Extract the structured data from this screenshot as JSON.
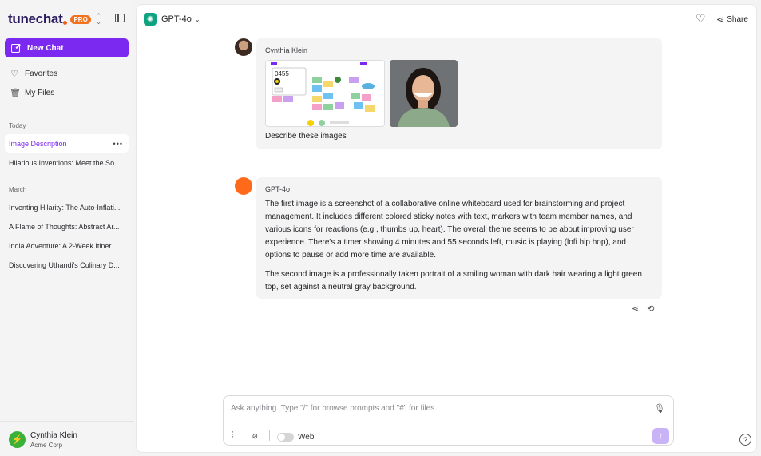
{
  "brand": {
    "name": "tunechat",
    "badge": "PRO"
  },
  "sidebar": {
    "new_chat_label": "New Chat",
    "nav": [
      {
        "label": "Favorites",
        "icon": "heart-icon"
      },
      {
        "label": "My Files",
        "icon": "files-icon"
      }
    ],
    "today_label": "Today",
    "today_items": [
      {
        "title": "Image Description",
        "active": true
      },
      {
        "title": "Hilarious Inventions: Meet the So..."
      }
    ],
    "march_label": "March",
    "march_items": [
      {
        "title": "Inventing Hilarity: The Auto-Inflati..."
      },
      {
        "title": "A Flame of Thoughts: Abstract Ar..."
      },
      {
        "title": "India Adventure: A 2-Week Itiner..."
      },
      {
        "title": "Discovering Uthandi's Culinary D..."
      }
    ]
  },
  "user": {
    "name": "Cynthia Klein",
    "org": "Acme Corp"
  },
  "header": {
    "model": "GPT-4o",
    "share_label": "Share"
  },
  "messages": [
    {
      "sender": "Cynthia Klein",
      "text": "Describe these images"
    },
    {
      "sender": "GPT-4o",
      "paragraphs": [
        "The first image is a screenshot of a collaborative online whiteboard used for brainstorming and project management. It includes different colored sticky notes with text, markers with team member names, and various icons for reactions (e.g., thumbs up, heart). The overall theme seems to be about improving user experience. There's a timer showing 4 minutes and 55 seconds left, music is playing (lofi hip hop), and options to pause or add more time are available.",
        "The second image is a professionally taken portrait of a smiling woman with dark hair wearing a light green top, set against a neutral gray background."
      ]
    }
  ],
  "attachment_timer": "0455",
  "composer": {
    "placeholder": "Ask anything. Type \"/\" for browse prompts and \"#\" for files.",
    "web_label": "Web"
  },
  "help_label": "?",
  "colors": {
    "accent": "#7b29f0",
    "brand_orange": "#f2721f",
    "bot_avatar": "#ff6a1a"
  }
}
